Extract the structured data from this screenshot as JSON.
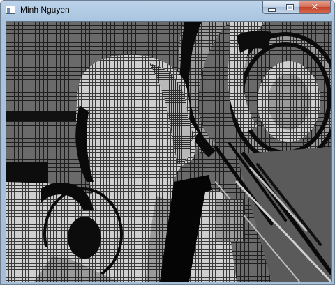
{
  "window": {
    "title": "Minh Nguyen",
    "controls": {
      "minimize_icon": "minimize-icon",
      "maximize_icon": "maximize-icon",
      "close_glyph": "✕"
    }
  },
  "scene": {
    "description_icon": "depth-mesh-image",
    "colors": {
      "background": "#5a5a5a",
      "mesh_light": "#c8c8c8",
      "mesh_dark": "#1a1a1a",
      "shadow": "#000000",
      "title_accent": "#a9c4df",
      "close_red": "#c2402a"
    }
  }
}
